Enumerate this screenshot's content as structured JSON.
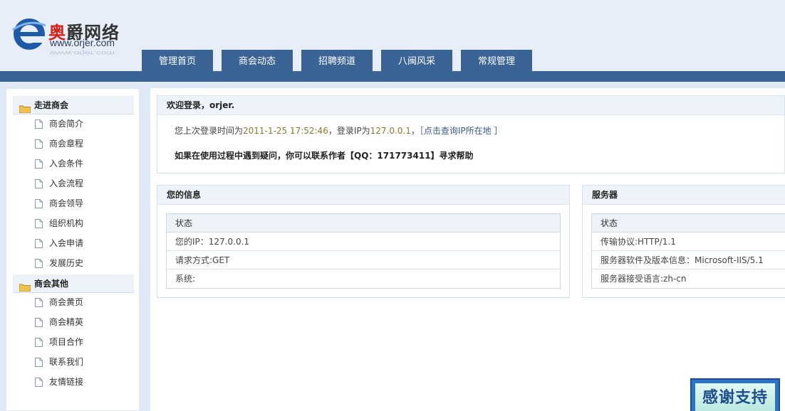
{
  "logo": {
    "cn_part1": "奥",
    "cn_part2": "爵网络",
    "en": "www.orjer.com"
  },
  "nav": {
    "tabs": [
      "管理首页",
      "商会动态",
      "招聘频道",
      "八闽风采",
      "常规管理"
    ]
  },
  "sidebar": {
    "groups": [
      {
        "title": "走进商会",
        "items": [
          "商会简介",
          "商会章程",
          "入会条件",
          "入会流程",
          "商会领导",
          "组织机构",
          "入会申请",
          "发展历史"
        ]
      },
      {
        "title": "商会其他",
        "items": [
          "商会黄页",
          "商会精英",
          "项目合作",
          "联系我们",
          "友情链接"
        ]
      }
    ]
  },
  "welcome": {
    "title": "欢迎登录，orjer.",
    "last_login_prefix": "您上次登录时间为",
    "last_login_time": "2011-1-25 17:52:46",
    "ip_prefix": "，登录IP为",
    "ip": "127.0.0.1",
    "ip_suffix": "，",
    "query_link": "［点击查询IP所在地 ］",
    "help": "如果在使用过程中遇到疑问，你可以联系作者【QQ：171773411】寻求帮助"
  },
  "info": {
    "title": "您的信息",
    "head": "状态",
    "rows": [
      "您的IP：127.0.0.1",
      "请求方式:GET",
      "系统:"
    ]
  },
  "server": {
    "title": "服务器",
    "head": "状态",
    "rows": [
      "传输协议:HTTP/1.1",
      "服务器软件及版本信息：Microsoft-IIS/5.1",
      "服务器接受语言:zh-cn"
    ]
  },
  "thanks_button": "感谢支持",
  "colors": {
    "nav_bg": "#3b6496",
    "page_bg": "#dfe9f5",
    "highlight": "#8a7a2c",
    "logo_red": "#d6201a"
  }
}
